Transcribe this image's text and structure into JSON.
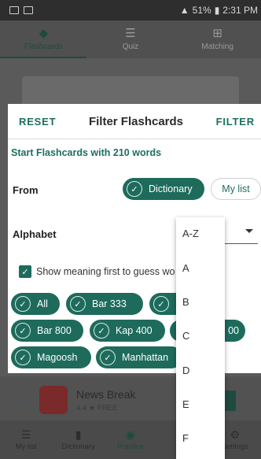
{
  "status_bar": {
    "battery": "51%",
    "time": "2:31 PM"
  },
  "top_tabs": [
    {
      "label": "Flashcards",
      "icon": "layers-icon",
      "active": true
    },
    {
      "label": "Quiz",
      "icon": "list-icon",
      "active": false
    },
    {
      "label": "Matching",
      "icon": "grid-icon",
      "active": false
    }
  ],
  "dialog": {
    "reset_label": "RESET",
    "title": "Filter Flashcards",
    "filter_label": "FILTER",
    "start_text": "Start Flashcards with 210 words",
    "from_label": "From",
    "from_options": [
      {
        "label": "Dictionary",
        "selected": true
      },
      {
        "label": "My list",
        "selected": false
      }
    ],
    "alphabet_label": "Alphabet",
    "show_meaning_label": "Show meaning first to guess wo",
    "chips": [
      {
        "label": "All",
        "selected": true
      },
      {
        "label": "Bar 333",
        "selected": true
      },
      {
        "label": "Ba",
        "selected": true
      },
      {
        "label": "Bar 800",
        "selected": true
      },
      {
        "label": "Kap 400",
        "selected": true
      },
      {
        "label": "00",
        "selected": true
      },
      {
        "label": "Magoosh",
        "selected": true
      },
      {
        "label": "Manhattan",
        "selected": true
      }
    ]
  },
  "alphabet_dropdown": {
    "options": [
      "A-Z",
      "A",
      "B",
      "C",
      "D",
      "E",
      "F"
    ]
  },
  "ad": {
    "name": "News Break",
    "rating": "4.4 ★",
    "price": "FREE"
  },
  "bottom_nav": [
    {
      "label": "My list",
      "icon": "list-icon",
      "active": false
    },
    {
      "label": "Dictionary",
      "icon": "book-icon",
      "active": false
    },
    {
      "label": "Practice",
      "icon": "gamepad-icon",
      "active": true
    },
    {
      "label": "A",
      "icon": "",
      "active": false
    },
    {
      "label": "Settings",
      "icon": "gear-icon",
      "active": false
    }
  ],
  "colors": {
    "accent": "#1e6b5c",
    "accent_text": "#1c6f5f"
  }
}
